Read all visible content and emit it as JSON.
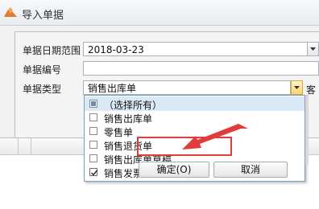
{
  "window": {
    "title": "导入单据"
  },
  "form": {
    "date_range_label": "单据日期范围",
    "date_value": "2018-03-23",
    "doc_number_label": "单据编号",
    "doc_number_value": "",
    "doc_type_label": "单据类型",
    "doc_type_value": "销售出库单",
    "customer_label": "客"
  },
  "doc_type_options": [
    {
      "label": "（选择所有）",
      "state": "partial"
    },
    {
      "label": "销售出库单",
      "state": "unchecked"
    },
    {
      "label": "零售单",
      "state": "unchecked"
    },
    {
      "label": "销售退货单",
      "state": "unchecked"
    },
    {
      "label": "销售出库单草稿",
      "state": "unchecked"
    },
    {
      "label": "销售发票",
      "state": "checked"
    }
  ],
  "popup_buttons": {
    "ok_label": "确定(O)",
    "cancel_label": "取消"
  },
  "annotation": {
    "highlight_color": "#e23b3b",
    "arrow_color": "#e23b3b"
  }
}
